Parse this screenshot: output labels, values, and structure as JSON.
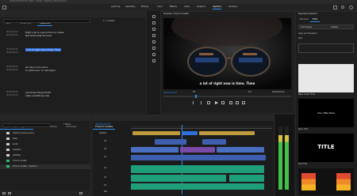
{
  "app": {
    "title": "Adobe Premiere Pro 2021 - /Users/.../Captions_Demo.prproj *",
    "workspaces": [
      "Learning",
      "Assembly",
      "Editing",
      "Color",
      "Effects",
      "Audio",
      "Graphics",
      "Captions",
      "Libraries"
    ],
    "active_workspace": "Captions"
  },
  "text_panel": {
    "tabs": [
      "Text",
      "Transcript",
      "Captions"
    ],
    "active_tab": "Captions",
    "search_placeholder": "",
    "count_label": "1 / 1 results",
    "captions": [
      {
        "time": "00;00;00;02",
        "end": "00;00;01;15",
        "text": "Right now is a good time to create.",
        "text2": "Not what what we have"
      },
      {
        "time": "00;00;03;15",
        "end": "00;00;05;04",
        "text": "a lot of right now is time. Time",
        "text2": ""
      },
      {
        "time": "00;00;05;05",
        "end": "00;00;06;17",
        "text": "we have to be alone",
        "text2": "to rediscover, to reimagine"
      },
      {
        "time": "00;00;06;18",
        "end": "00;00;08;10",
        "text": "and those things that's",
        "text2": "really something new"
      }
    ]
  },
  "program": {
    "header": "Program: Time to Create",
    "caption": "a lot of right now is time. Time",
    "timecode": "00;00;04;01",
    "zoom": "Fit",
    "quality": "Full",
    "duration": "00;00;41;01"
  },
  "essential_graphics": {
    "title": "Essential Graphics",
    "tabs": [
      "Browse",
      "Edit"
    ],
    "active_tab": "Edit",
    "sections": [
      {
        "label": "Track Styles",
        "value": "Subtitle"
      },
      {
        "label": "Align and Transform",
        "value": ""
      },
      {
        "label": "Text",
        "value": ""
      }
    ],
    "templates": [
      {
        "label": "Basic Lower Third"
      },
      {
        "label": "Basic Title",
        "preview_text": "Your Title Here"
      },
      {
        "label": "Bold Title",
        "preview_text": "TITLE"
      },
      {
        "label": "Bold Lower Third"
      }
    ]
  },
  "project": {
    "tabs": [
      "Project: Captions_Demo",
      "Media Browser",
      "Libraries"
    ],
    "items": [
      "Captions_Demo.prproj",
      "Clips",
      "Audio",
      "Graphics",
      "Subtitles",
      "Time to Create",
      "Time to Create - Captions"
    ],
    "item_count": "7 Items"
  },
  "tools": [
    "selection-tool",
    "track-select-tool",
    "ripple-edit-tool",
    "razor-tool",
    "slip-tool",
    "pen-tool",
    "hand-tool",
    "type-tool"
  ],
  "timeline": {
    "tab": "Time to Create",
    "timecode": "00;00;04;01",
    "tracks": [
      "V3",
      "V2",
      "V1",
      "A1",
      "A2",
      "A3",
      "Mix"
    ],
    "caption_track": "Subtitle",
    "audio_meter_levels": [
      0.86,
      0.86
    ]
  },
  "colors": {
    "accent": "#2d8ceb",
    "video_clip": "#3e5fb0",
    "audio_clip": "#1f9e7a",
    "caption_clip": "#c09a3e",
    "selection": "#2d6fdb"
  }
}
